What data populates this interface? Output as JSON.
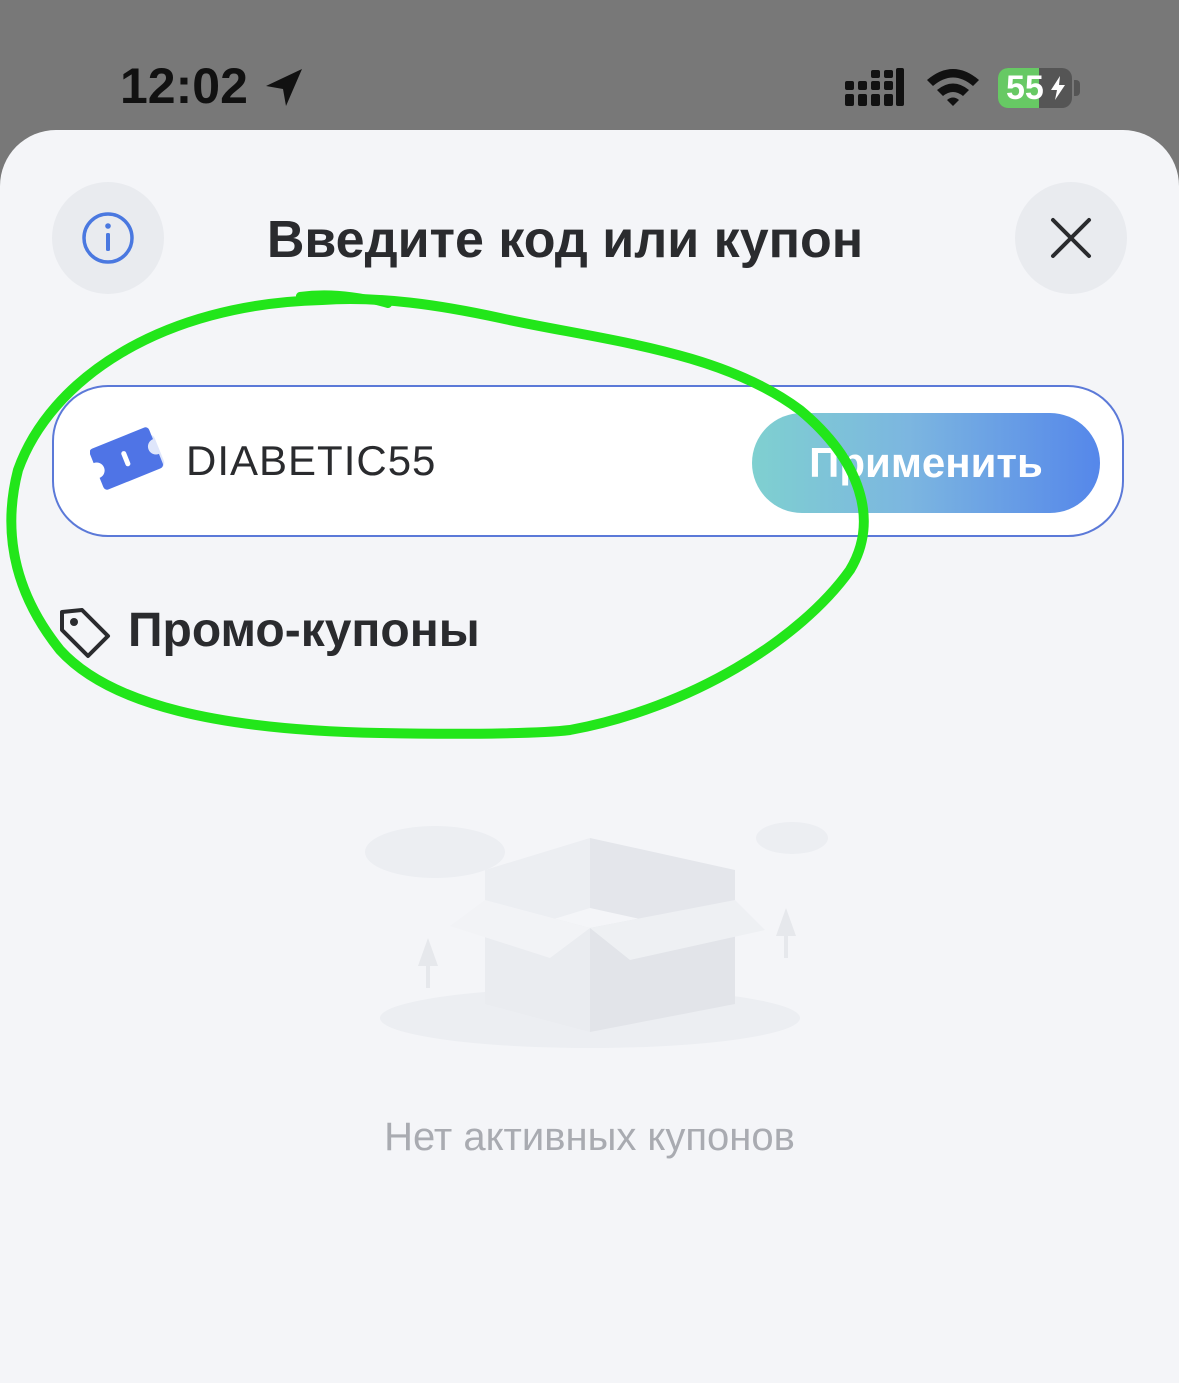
{
  "status_bar": {
    "time": "12:02",
    "battery_level": "55",
    "battery_fraction": 0.55
  },
  "sheet": {
    "title": "Введите код или купон"
  },
  "coupon_form": {
    "code_value": "DIABETIC55",
    "apply_label": "Применить"
  },
  "promo": {
    "section_title": "Промо-купоны",
    "empty_message": "Нет активных купонов"
  },
  "colors": {
    "accent_blue": "#5b79d8",
    "annotation_green": "#22e61a",
    "sheet_background": "#f4f5f8",
    "status_bar_background": "#787878"
  },
  "icons": {
    "info": "info-icon",
    "close": "close-icon",
    "coupon": "coupon-ticket-icon",
    "tag": "tag-icon",
    "location": "location-arrow-icon",
    "signal": "cellular-signal-icon",
    "wifi": "wifi-icon"
  }
}
